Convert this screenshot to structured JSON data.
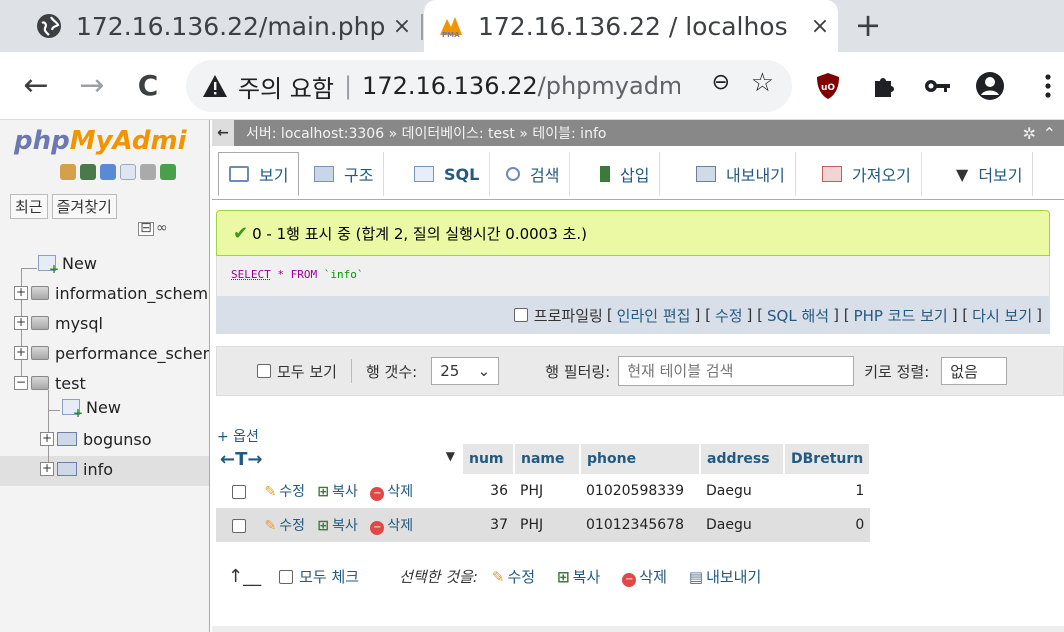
{
  "browser": {
    "tabs": [
      {
        "title": "172.16.136.22/main.php",
        "close": "×",
        "icon": "globe-icon"
      },
      {
        "title": "172.16.136.22 / localhos",
        "close": "×",
        "icon": "phpmyadmin-icon"
      }
    ],
    "new_tab": "+",
    "nav": {
      "back": "←",
      "forward": "→",
      "reload": "C"
    },
    "omnibox": {
      "warning_label": "주의 요함",
      "separator": "|",
      "host": "172.16.136.22",
      "path": "/phpmyadmin/",
      "zoom_icon": "⊖",
      "star_icon": "☆"
    },
    "extensions": [
      "ublock-icon",
      "puzzle-icon",
      "key-icon",
      "profile-icon",
      "menu-icon"
    ]
  },
  "left": {
    "logo_php": "php",
    "logo_my": "MyAdmi",
    "tabs": [
      "최근",
      "즐겨찾기"
    ],
    "collapse": "⊟",
    "link": "∞",
    "tree": [
      {
        "label": "New",
        "level": 0
      },
      {
        "label": "information_schema",
        "level": 0
      },
      {
        "label": "mysql",
        "level": 0
      },
      {
        "label": "performance_schema",
        "level": 0
      },
      {
        "label": "test",
        "level": 0
      },
      {
        "label": "New",
        "level": 1
      },
      {
        "label": "bogunso",
        "level": 1
      },
      {
        "label": "info",
        "level": 1
      }
    ]
  },
  "breadcrumb": {
    "back": "←",
    "text": "서버: localhost:3306 » 데이터베이스: test » 테이블: info"
  },
  "menu": {
    "tabs": [
      "보기",
      "구조",
      "SQL",
      "검색",
      "삽입",
      "내보내기",
      "가져오기",
      "더보기"
    ]
  },
  "result": {
    "message": "0 - 1행 표시 중 (합계 2, 질의 실행시간 0.0003 초.)",
    "sql_select": "SELECT",
    "sql_rest": " * FROM ",
    "sql_table": "`info`",
    "profiling": "프로파일링",
    "links": [
      "인라인 편집",
      "수정",
      "SQL 해석",
      "PHP 코드 보기",
      "다시 보기"
    ]
  },
  "navbar": {
    "show_all": "모두 보기",
    "row_count_label": "행 갯수:",
    "row_count_value": "25",
    "filter_label": "행 필터링:",
    "filter_placeholder": "현재 테이블 검색",
    "sort_label": "키로 정렬:",
    "sort_value": "없음"
  },
  "table": {
    "options": "+ 옵션",
    "columns": [
      "num",
      "name",
      "phone",
      "address",
      "DBreturn"
    ],
    "actions": {
      "edit": "수정",
      "copy": "복사",
      "delete": "삭제"
    },
    "rows": [
      {
        "num": "36",
        "name": "PHJ",
        "phone": "01020598339",
        "address": "Daegu",
        "DBreturn": "1"
      },
      {
        "num": "37",
        "name": "PHJ",
        "phone": "01012345678",
        "address": "Daegu",
        "DBreturn": "0"
      }
    ]
  },
  "bottom": {
    "check_all": "모두 체크",
    "with_selected": "선택한 것을:",
    "edit": "수정",
    "copy": "복사",
    "delete": "삭제",
    "export": "내보내기"
  },
  "colors": {
    "chrome_bg": "#dee1e6",
    "pma_link": "#235a81",
    "success_bg": "#ebf8a4",
    "logo_orange": "#f29400",
    "logo_blue": "#6c78af"
  }
}
